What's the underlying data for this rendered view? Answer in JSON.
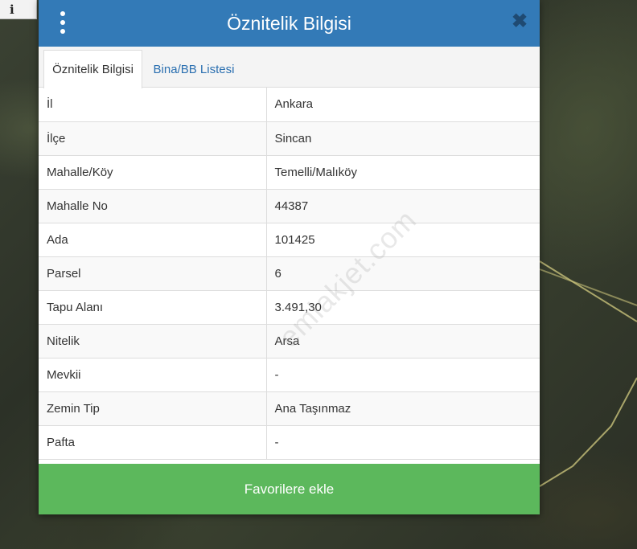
{
  "map": {
    "info_icon_glyph": "i",
    "parcel_outline_color": "#c8c27a"
  },
  "dialog": {
    "title": "Öznitelik Bilgisi",
    "close_glyph": "✖",
    "header_color": "#337ab7"
  },
  "tabs": [
    {
      "label": "Öznitelik Bilgisi",
      "active": true
    },
    {
      "label": "Bina/BB Listesi",
      "active": false
    }
  ],
  "attributes": [
    {
      "key": "İl",
      "value": "Ankara"
    },
    {
      "key": "İlçe",
      "value": "Sincan"
    },
    {
      "key": "Mahalle/Köy",
      "value": "Temelli/Malıköy"
    },
    {
      "key": "Mahalle No",
      "value": "44387"
    },
    {
      "key": "Ada",
      "value": "101425"
    },
    {
      "key": "Parsel",
      "value": "6"
    },
    {
      "key": "Tapu Alanı",
      "value": "3.491,30"
    },
    {
      "key": "Nitelik",
      "value": "Arsa"
    },
    {
      "key": "Mevkii",
      "value": "-"
    },
    {
      "key": "Zemin Tip",
      "value": "Ana Taşınmaz"
    },
    {
      "key": "Pafta",
      "value": "-"
    }
  ],
  "actions": {
    "favorite_label": "Favorilere ekle",
    "favorite_color": "#5cb85c"
  },
  "watermark": "emlakjet.com"
}
